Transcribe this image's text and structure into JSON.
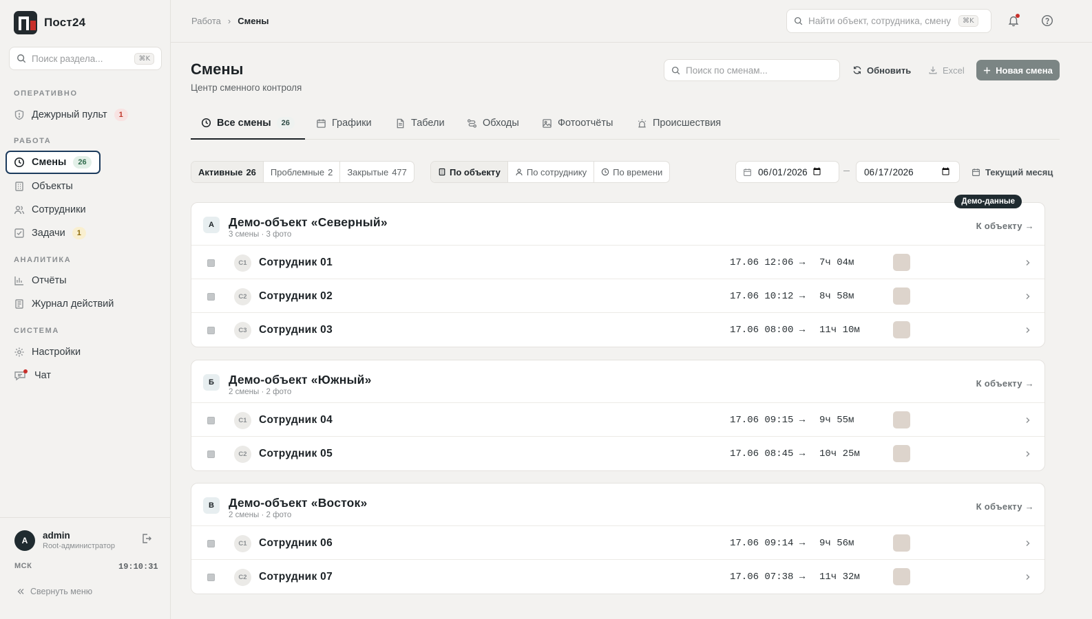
{
  "app": {
    "name": "Пост24"
  },
  "sidebar": {
    "search_placeholder": "Поиск раздела...",
    "search_shortcut": "⌘K",
    "sections": {
      "ops": "ОПЕРАТИВНО",
      "work": "РАБОТА",
      "analytics": "АНАЛИТИКА",
      "system": "СИСТЕМА"
    },
    "items": {
      "duty": {
        "label": "Дежурный пульт",
        "badge": "1",
        "icon": "shield-icon"
      },
      "shifts": {
        "label": "Смены",
        "badge": "26",
        "icon": "clock-icon"
      },
      "objects": {
        "label": "Объекты",
        "icon": "building-icon"
      },
      "staff": {
        "label": "Сотрудники",
        "icon": "users-icon"
      },
      "tasks": {
        "label": "Задачи",
        "badge": "1",
        "icon": "checkbox-icon"
      },
      "reports": {
        "label": "Отчёты",
        "icon": "bar-chart-icon"
      },
      "journal": {
        "label": "Журнал действий",
        "icon": "log-icon"
      },
      "settings": {
        "label": "Настройки",
        "icon": "gear-icon"
      },
      "chat": {
        "label": "Чат",
        "icon": "chat-icon"
      }
    },
    "user": {
      "avatar": "A",
      "name": "admin",
      "role": "Root-администратор"
    },
    "timezone": "МСК",
    "clock": "19:10:31",
    "collapse_label": "Свернуть меню"
  },
  "topbar": {
    "breadcrumb": {
      "parent": "Работа",
      "separator": "›",
      "current": "Смены"
    },
    "search_placeholder": "Найти объект, сотрудника, смену",
    "search_shortcut": "⌘K"
  },
  "page": {
    "title": "Смены",
    "subtitle": "Центр сменного контроля",
    "search_placeholder": "Поиск по сменам...",
    "refresh_label": "Обновить",
    "excel_label": "Excel",
    "new_label": "Новая смена"
  },
  "tabs": [
    {
      "label": "Все смены",
      "count": "26",
      "icon": "clock-icon"
    },
    {
      "label": "Графики",
      "icon": "calendar-icon"
    },
    {
      "label": "Табели",
      "icon": "document-icon"
    },
    {
      "label": "Обходы",
      "icon": "route-icon"
    },
    {
      "label": "Фотоотчёты",
      "icon": "image-icon"
    },
    {
      "label": "Происшествия",
      "icon": "alarm-icon"
    }
  ],
  "status_filter": [
    {
      "label": "Активные",
      "count": "26"
    },
    {
      "label": "Проблемные",
      "count": "2"
    },
    {
      "label": "Закрытые",
      "count": "477"
    }
  ],
  "group_filter": [
    {
      "label": "По объекту",
      "icon": "building-icon"
    },
    {
      "label": "По сотруднику",
      "icon": "user-icon"
    },
    {
      "label": "По времени",
      "icon": "clock-icon"
    }
  ],
  "date_range": {
    "from": "2026-06-01",
    "to": "2026-06-17"
  },
  "current_month_label": "Текущий месяц",
  "demo_tag": "Демо-данные",
  "colors": {
    "accent": "#1b3a5c",
    "primary_button": "#7b8584",
    "danger": "#c8302b"
  },
  "groups": [
    {
      "letter": "А",
      "title": "Демо-объект «Северный»",
      "meta": "3 смены · 3 фото",
      "link": "К объекту →",
      "rows": [
        {
          "initials": "С1",
          "name": "Сотрудник 01",
          "start": "17.06 12:06 →",
          "duration": "7ч 04м"
        },
        {
          "initials": "С2",
          "name": "Сотрудник 02",
          "start": "17.06 10:12 →",
          "duration": "8ч 58м"
        },
        {
          "initials": "С3",
          "name": "Сотрудник 03",
          "start": "17.06 08:00 →",
          "duration": "11ч 10м"
        }
      ]
    },
    {
      "letter": "Б",
      "title": "Демо-объект «Южный»",
      "meta": "2 смены · 2 фото",
      "link": "К объекту →",
      "rows": [
        {
          "initials": "С1",
          "name": "Сотрудник 04",
          "start": "17.06 09:15 →",
          "duration": "9ч 55м"
        },
        {
          "initials": "С2",
          "name": "Сотрудник 05",
          "start": "17.06 08:45 →",
          "duration": "10ч 25м"
        }
      ]
    },
    {
      "letter": "В",
      "title": "Демо-объект «Восток»",
      "meta": "2 смены · 2 фото",
      "link": "К объекту →",
      "rows": [
        {
          "initials": "С1",
          "name": "Сотрудник 06",
          "start": "17.06 09:14 →",
          "duration": "9ч 56м"
        },
        {
          "initials": "С2",
          "name": "Сотрудник 07",
          "start": "17.06 07:38 →",
          "duration": "11ч 32м"
        }
      ]
    }
  ]
}
